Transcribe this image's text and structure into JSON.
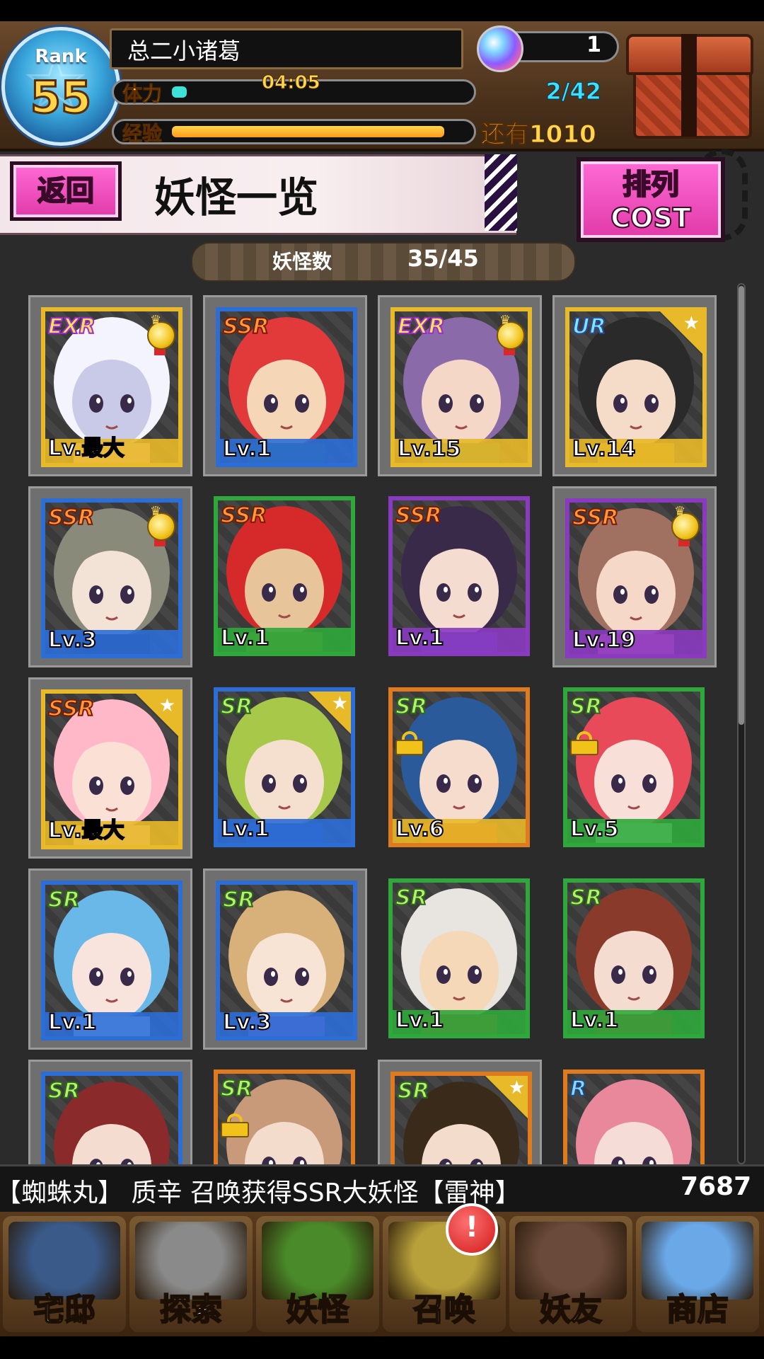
{
  "header": {
    "rank_label": "Rank",
    "rank_value": "55",
    "player_name": "总二小诸葛",
    "stamina_label": "体力",
    "stamina_timer": "04:05",
    "stamina_count": "2/42",
    "stamina_fill_fraction": 0.05,
    "exp_label": "经验",
    "exp_fill_fraction": 0.94,
    "exp_remaining": "还有1010",
    "orb_count": "1"
  },
  "titlebar": {
    "back_label": "返回",
    "page_title": "妖怪一览",
    "sort_line1": "排列",
    "sort_line2": "COST"
  },
  "counter": {
    "label": "妖怪数",
    "value": "35/45"
  },
  "cards": [
    {
      "rarity": "EXR",
      "level": "Lv.最大",
      "frame": "gold",
      "medal": true,
      "star": false,
      "lock": false,
      "selected": true,
      "palette": [
        "#f4f4ff",
        "#c9c9e8",
        "#ffc6d8"
      ]
    },
    {
      "rarity": "SSR",
      "level": "Lv.1",
      "frame": "blue",
      "medal": false,
      "star": false,
      "lock": false,
      "selected": true,
      "palette": [
        "#e23a3a",
        "#f5d7b8",
        "#3a6a2a"
      ]
    },
    {
      "rarity": "EXR",
      "level": "Lv.15",
      "frame": "gold",
      "medal": true,
      "star": false,
      "lock": false,
      "selected": true,
      "palette": [
        "#8a6aa8",
        "#f5d7c8",
        "#2a7a6a"
      ]
    },
    {
      "rarity": "UR",
      "level": "Lv.14",
      "frame": "gold",
      "medal": false,
      "star": true,
      "lock": false,
      "selected": true,
      "palette": [
        "#2a2a2a",
        "#f5dcc8",
        "#c8a02a"
      ]
    },
    {
      "rarity": "SSR",
      "level": "Lv.3",
      "frame": "blue",
      "medal": true,
      "star": false,
      "lock": false,
      "selected": true,
      "palette": [
        "#8a8a7a",
        "#f3e3d6",
        "#1a1a2a"
      ]
    },
    {
      "rarity": "SSR",
      "level": "Lv.1",
      "frame": "green",
      "medal": false,
      "star": false,
      "lock": false,
      "selected": false,
      "palette": [
        "#d62a2a",
        "#e8c49a",
        "#a4743a"
      ]
    },
    {
      "rarity": "SSR",
      "level": "Lv.1",
      "frame": "purple",
      "medal": false,
      "star": false,
      "lock": false,
      "selected": false,
      "palette": [
        "#3a2a4a",
        "#f5dcd0",
        "#4a5ac8"
      ]
    },
    {
      "rarity": "SSR",
      "level": "Lv.19",
      "frame": "purple",
      "medal": true,
      "star": false,
      "lock": false,
      "selected": true,
      "palette": [
        "#a07060",
        "#f5d8c8",
        "#ff8aa8"
      ]
    },
    {
      "rarity": "SSR",
      "level": "Lv.最大",
      "frame": "gold",
      "medal": false,
      "star": true,
      "lock": false,
      "selected": true,
      "palette": [
        "#ffb8c8",
        "#fbe0d6",
        "#ffd0d8"
      ]
    },
    {
      "rarity": "SR",
      "level": "Lv.1",
      "frame": "blue",
      "medal": false,
      "star": true,
      "lock": false,
      "selected": false,
      "palette": [
        "#a8c84a",
        "#f5e0d0",
        "#2a5aa8"
      ]
    },
    {
      "rarity": "SR",
      "level": "Lv.6",
      "frame": "orange",
      "medal": false,
      "star": false,
      "lock": true,
      "selected": false,
      "palette": [
        "#2a5a9a",
        "#f5dccc",
        "#c83a2a"
      ]
    },
    {
      "rarity": "SR",
      "level": "Lv.5",
      "frame": "green",
      "medal": false,
      "star": false,
      "lock": true,
      "selected": false,
      "palette": [
        "#e84a5a",
        "#f8e0d8",
        "#ffffff"
      ]
    },
    {
      "rarity": "SR",
      "level": "Lv.1",
      "frame": "blue",
      "medal": false,
      "star": false,
      "lock": false,
      "selected": true,
      "palette": [
        "#6ab8e8",
        "#f8e4dc",
        "#ffffff"
      ]
    },
    {
      "rarity": "SR",
      "level": "Lv.3",
      "frame": "blue",
      "medal": false,
      "star": false,
      "lock": false,
      "selected": true,
      "palette": [
        "#d8b07a",
        "#f8e4d4",
        "#c86ac8"
      ]
    },
    {
      "rarity": "SR",
      "level": "Lv.1",
      "frame": "green",
      "medal": false,
      "star": false,
      "lock": false,
      "selected": false,
      "palette": [
        "#e8e4e0",
        "#f4d8b8",
        "#c83a2a"
      ]
    },
    {
      "rarity": "SR",
      "level": "Lv.1",
      "frame": "green",
      "medal": false,
      "star": false,
      "lock": false,
      "selected": false,
      "palette": [
        "#8a3a2a",
        "#f5dcd0",
        "#c8202a"
      ]
    },
    {
      "rarity": "SR",
      "level": "",
      "frame": "blue",
      "medal": false,
      "star": false,
      "lock": false,
      "selected": true,
      "palette": [
        "#8a2a2a",
        "#f5dcd0",
        "#3a2a2a"
      ]
    },
    {
      "rarity": "SR",
      "level": "",
      "frame": "orange",
      "medal": false,
      "star": false,
      "lock": true,
      "selected": false,
      "palette": [
        "#c89a7a",
        "#f3dccc",
        "#3a2a1a"
      ]
    },
    {
      "rarity": "SR",
      "level": "",
      "frame": "orange",
      "medal": false,
      "star": true,
      "lock": false,
      "selected": true,
      "palette": [
        "#3a2a1a",
        "#f3dccc",
        "#8a6a4a"
      ]
    },
    {
      "rarity": "R",
      "level": "",
      "frame": "orange",
      "medal": false,
      "star": false,
      "lock": false,
      "selected": false,
      "palette": [
        "#e8889a",
        "#f5dcd6",
        "#a05a4a"
      ]
    }
  ],
  "ticker": {
    "text": "【蜘蛛丸】      质辛 召唤获得SSR大妖怪【雷神】",
    "trailing": "7687"
  },
  "nav": {
    "items": [
      {
        "label": "宅邸",
        "icon": "mansion-icon",
        "color": "#3a5a8a"
      },
      {
        "label": "探索",
        "icon": "magnifier-icon",
        "color": "#8a8a8a"
      },
      {
        "label": "妖怪",
        "icon": "scroll-icon",
        "color": "#4a8a2a"
      },
      {
        "label": "召唤",
        "icon": "summon-star-icon",
        "color": "#b8a03a"
      },
      {
        "label": "妖友",
        "icon": "friend-girl-icon",
        "color": "#6a4a3a"
      },
      {
        "label": "商店",
        "icon": "orb-icon",
        "color": "#6aa8e8"
      }
    ],
    "badge": "!"
  }
}
